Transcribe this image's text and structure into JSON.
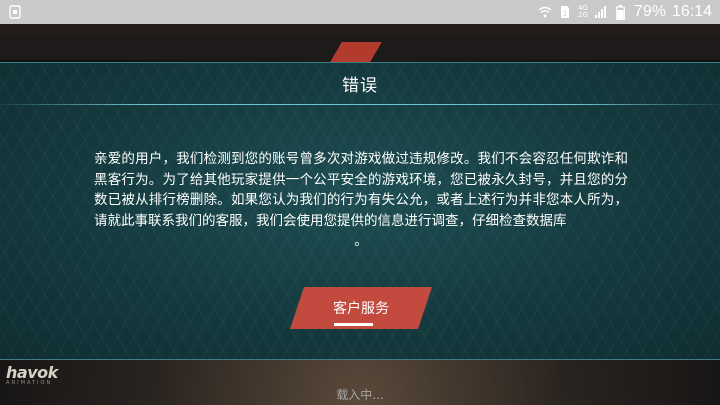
{
  "status_bar": {
    "battery_percent": "79%",
    "time": "16:14",
    "network_top": "4G",
    "network_bottom": "2G",
    "icons": [
      "notification-icon",
      "wifi-icon",
      "sim-icon",
      "signal-icon",
      "battery-icon"
    ]
  },
  "dialog": {
    "title": "错误",
    "message": "亲爱的用户，我们检测到您的账号曾多次对游戏做过违规修改。我们不会容忍任何欺诈和黑客行为。为了给其他玩家提供一个公平安全的游戏环境，您已被永久封号，并且您的分数已被从排行榜删除。如果您认为我们的行为有失公允，或者上述行为并非您本人所为，请就此事联系我们的客服，我们会使用您提供的信息进行调查，仔细检查数据库",
    "message_end": "。",
    "button_label": "客户服务"
  },
  "footer": {
    "logo_text": "havok",
    "logo_sub": "ANIMATION",
    "loading_text": "载入中..."
  },
  "colors": {
    "panel": "#143a3e",
    "button": "#c24a3e",
    "status_bar": "#c9c9c9"
  }
}
